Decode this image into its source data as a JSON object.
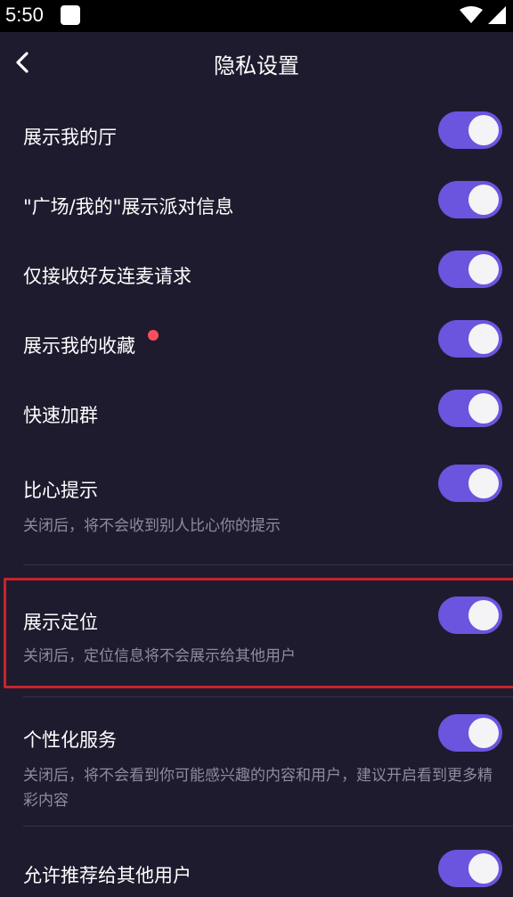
{
  "status_bar": {
    "time": "5:50"
  },
  "header": {
    "title": "隐私设置"
  },
  "settings": [
    {
      "label": "展示我的厅",
      "enabled": true
    },
    {
      "label": "\"广场/我的\"展示派对信息",
      "enabled": true
    },
    {
      "label": "仅接收好友连麦请求",
      "enabled": true
    },
    {
      "label": "展示我的收藏",
      "enabled": true,
      "has_new_badge": true
    },
    {
      "label": "快速加群",
      "enabled": true
    },
    {
      "label": "比心提示",
      "enabled": true,
      "description": "关闭后，将不会收到别人比心你的提示"
    },
    {
      "label": "展示定位",
      "enabled": true,
      "description": "关闭后，定位信息将不会展示给其他用户",
      "highlighted": true
    },
    {
      "label": "个性化服务",
      "enabled": true,
      "description": "关闭后，将不会看到你可能感兴趣的内容和用户，建议开启看到更多精彩内容"
    },
    {
      "label": "允许推荐给其他用户",
      "enabled": true
    }
  ],
  "colors": {
    "background": "#1f1b2e",
    "toggle_on": "#6b54de",
    "highlight_border": "#c8232c",
    "badge": "#ff4d5e"
  }
}
